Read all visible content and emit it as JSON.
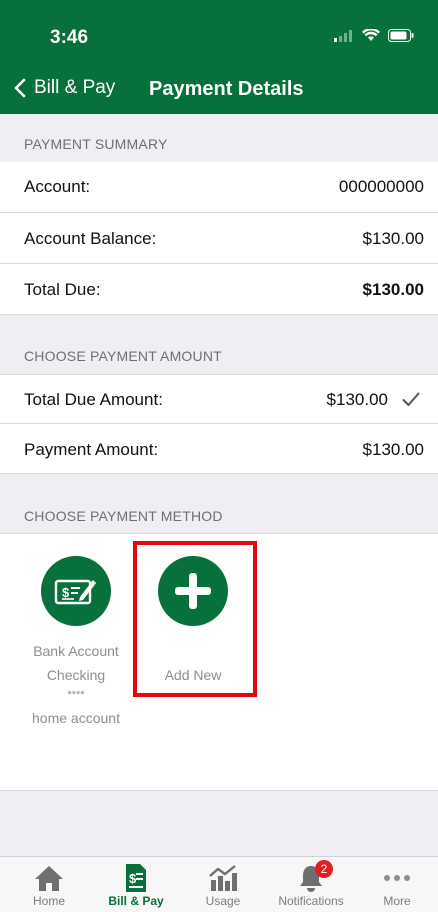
{
  "status_bar": {
    "time": "3:46"
  },
  "nav": {
    "back_label": "Bill & Pay",
    "title": "Payment Details"
  },
  "payment_summary": {
    "header": "PAYMENT SUMMARY",
    "rows": [
      {
        "label": "Account:",
        "value": "000000000"
      },
      {
        "label": "Account Balance:",
        "value": "$130.00"
      },
      {
        "label": "Total Due:",
        "value": "$130.00"
      }
    ]
  },
  "payment_amount": {
    "header": "CHOOSE PAYMENT AMOUNT",
    "rows": [
      {
        "label": "Total Due Amount:",
        "value": "$130.00",
        "checked": true
      },
      {
        "label": "Payment Amount:",
        "value": "$130.00"
      }
    ]
  },
  "payment_method": {
    "header": "CHOOSE PAYMENT METHOD",
    "methods": [
      {
        "line1": "Bank Account",
        "line2": "Checking",
        "masked": "****",
        "nickname": "home account",
        "icon": "check-icon"
      },
      {
        "line1": "Add New",
        "icon": "plus-icon"
      }
    ]
  },
  "tabs": [
    {
      "label": "Home",
      "icon": "home-icon"
    },
    {
      "label": "Bill & Pay",
      "icon": "bill-icon",
      "active": true
    },
    {
      "label": "Usage",
      "icon": "usage-chart-icon"
    },
    {
      "label": "Notifications",
      "icon": "bell-icon",
      "badge": "2"
    },
    {
      "label": "More",
      "icon": "more-dots-icon"
    }
  ],
  "colors": {
    "brand_green": "#08703a",
    "highlight_red": "#e30613",
    "badge_red": "#e02020"
  }
}
